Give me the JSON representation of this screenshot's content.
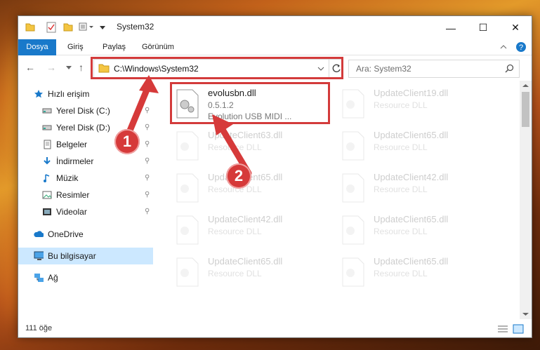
{
  "window": {
    "title": "System32",
    "controls": {
      "minimize": "—",
      "maximize": "☐",
      "close": "✕"
    }
  },
  "ribbon": {
    "tabs": [
      "Dosya",
      "Giriş",
      "Paylaş",
      "Görünüm"
    ]
  },
  "address": {
    "path": "C:\\Windows\\System32",
    "search_placeholder": "Ara: System32"
  },
  "sidebar": {
    "quick_access": "Hızlı erişim",
    "items": [
      {
        "label": "Yerel Disk (C:)",
        "icon": "drive-icon"
      },
      {
        "label": "Yerel Disk (D:)",
        "icon": "drive-icon"
      },
      {
        "label": "Belgeler",
        "icon": "documents-icon"
      },
      {
        "label": "İndirmeler",
        "icon": "download-icon"
      },
      {
        "label": "Müzik",
        "icon": "music-icon"
      },
      {
        "label": "Resimler",
        "icon": "pictures-icon"
      },
      {
        "label": "Videolar",
        "icon": "videos-icon"
      }
    ],
    "onedrive": "OneDrive",
    "this_pc": "Bu bilgisayar",
    "network": "Ağ"
  },
  "files": {
    "highlighted": {
      "name": "evolusbn.dll",
      "version": "0.5.1.2",
      "description": "Evolution USB MIDI ..."
    },
    "background": [
      {
        "name": "UpdateClient19.dll",
        "type": "Resource DLL"
      },
      {
        "name": "UpdateClient63.dll",
        "type": "Resource DLL"
      },
      {
        "name": "UpdateClient65.dll",
        "type": "Resource DLL"
      },
      {
        "name": "UpdateClient65.dll",
        "type": "Resource DLL"
      },
      {
        "name": "UpdateClient42.dll",
        "type": "Resource DLL"
      },
      {
        "name": "UpdateClient42.dll",
        "type": "Resource DLL"
      },
      {
        "name": "UpdateClient65.dll",
        "type": "Resource DLL"
      },
      {
        "name": "UpdateClient65.dll",
        "type": "Resource DLL"
      },
      {
        "name": "UpdateClient65.dll",
        "type": "Resource DLL"
      }
    ]
  },
  "status": {
    "count": "111 öğe"
  },
  "callouts": {
    "one": "1",
    "two": "2"
  },
  "colors": {
    "accent": "#1979ca",
    "callout": "#d63a3a",
    "selection": "#cce8ff"
  }
}
